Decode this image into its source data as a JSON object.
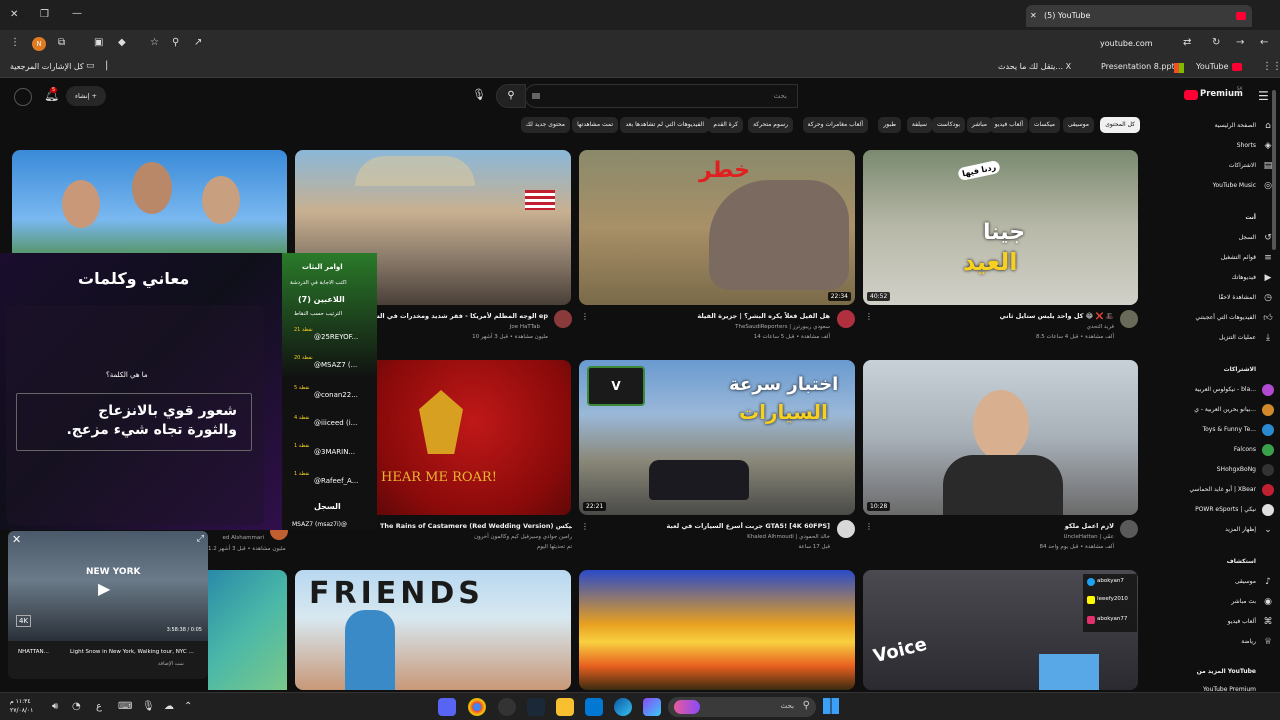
{
  "browser": {
    "tab_title": "(5) YouTube",
    "url": "youtube.com",
    "bookmarks": [
      {
        "label": "كل الإشارات المرجعية"
      },
      {
        "label": "يتقل لك ما يحدث... X"
      },
      {
        "label": "Presentation 8.pptx"
      },
      {
        "label": "YouTube"
      }
    ]
  },
  "youtube": {
    "logo_text": "Premium",
    "logo_badge": "SA",
    "create_label": "إنشاء",
    "notif_count": "5",
    "search_placeholder": "بحث",
    "chips": [
      "كل المحتوى",
      "موسيقى",
      "ميكسات",
      "ألعاب فيديو",
      "مباشر",
      "بودكاست",
      "سيلفة",
      "طبور",
      "ألعاب مغامرات وحركة",
      "رسوم متحركة",
      "كرة القدم",
      "الفيديوهات التي لم تشاهدها بعد",
      "تمت مشاهدتها",
      "محتوى جديد لك"
    ],
    "sidebar": {
      "main": [
        "الصفحة الرئيسية",
        "Shorts",
        "الاشتراكات",
        "YouTube Music"
      ],
      "you_header": "أنت",
      "you": [
        "السجل",
        "قوائم التشغيل",
        "فيديوهاتك",
        "المشاهدة لاحقًا",
        "الفيديوهات التي أعجبتني",
        "عمليات التنزيل"
      ],
      "subs_header": "الاشتراكات",
      "subs": [
        "نيكولوس العربية - bla...",
        "بيانو بحرين العربية - ي...",
        "Toys & Funny Te...",
        "Falcons",
        "SHohgxBoNg",
        "أبو غايد الحماسي | XBear",
        "POWR eSports | نيكي",
        "إظهار المزيد"
      ],
      "explore_header": "استكشاف",
      "explore": [
        "موسيقى",
        "بث مباشر",
        "ألعاب فيديو",
        "رياضة"
      ],
      "more_header": "المزيد من YouTube",
      "more": [
        "YouTube Premium"
      ]
    },
    "videos_row1": [
      {
        "title": "",
        "channel": "",
        "meta": "",
        "duration": ""
      },
      {
        "title": "الوجه المظلم لأمريكا - فقر شديد ومخدرات في الشارع ep",
        "channel": "Joe HaTTab",
        "meta": "10 مليون مشاهدة • قبل 3 أشهر",
        "duration": ""
      },
      {
        "title": "هل الفيل فعلاً يكره البشر؟ | جزيرة الفيلة",
        "channel": "TheSaudiReporters | سعودي ريبورترز",
        "meta": "14 ألف مشاهدة • قبل 5 ساعات",
        "duration": "22:34"
      },
      {
        "title": "كل واحد يلبس ستايل ثاني 😂 ❌ 🎩",
        "channel": "فريد التحدي",
        "meta": "8.5 ألف مشاهدة • قبل 4 ساعات",
        "duration": "40:52"
      }
    ],
    "videos_row2": [
      {
        "title": "",
        "channel": "ed Alshammari",
        "meta": "1.2 مليون مشاهدة • قبل 3 أشهر",
        "duration": ""
      },
      {
        "title": "The Rains of Castamere (Red Wedding Version) ميكس",
        "channel": "رامين جوادي وسيرفيل كيم وكالمون أخرون",
        "meta": "تم تحديثها اليوم",
        "duration": ""
      },
      {
        "title": "جربت أسرع السيارات في لعبة GTA5! [4K 60FPS]",
        "channel": "Khaled Alhmoudi | خالد الحمودي",
        "meta": "قبل 17 ساعة",
        "duration": "22:21"
      },
      {
        "title": "لازم اعمل ملكو",
        "channel": "UncleHattan | عمّي",
        "meta": "84 ألف مشاهدة • قبل يوم واحد",
        "duration": "10:28"
      }
    ],
    "thumb_texts": {
      "t3": "خطر",
      "t4a": "جينا",
      "t4b": "العيد",
      "t4c": "ردنا فيها",
      "t6": "HEAR ME ROAR!",
      "t7a": "اختبار سرعة",
      "t7b": "السيارات",
      "t10": "FRIENDS",
      "t12": "Voice"
    },
    "social": [
      "abokyan7",
      "Ieeefy2010",
      "abokyan77"
    ]
  },
  "overlay": {
    "title": "معاني وكلمات",
    "question": "ما هي الكلمة؟",
    "answer_line1": "شعور قوي بالانزعاج",
    "answer_line2": "والثورة تجاه شيء مزعج.",
    "cmd_header": "اوامر البثات",
    "cmd_sub": "اكتب الاجابة في الدردشة",
    "players_header": "اللاعبين (7)",
    "sort_label": "الترتيب حسب النقاط",
    "players": [
      {
        "name": "@25REYOF...",
        "points": "21 نقطة"
      },
      {
        "name": "@MSAZ7 (...",
        "points": "20 نقطة"
      },
      {
        "name": "@conan22...",
        "points": "5 نقطة"
      },
      {
        "name": "@iiiceed (i...",
        "points": "4 نقطة"
      },
      {
        "name": "@3MARIN...",
        "points": "1 نقطة"
      },
      {
        "name": "@Rafeef_A...",
        "points": "1 نقطة"
      }
    ],
    "log_header": "السجل",
    "log_entry": "MSAZ7 (msaz7i)@"
  },
  "miniplayer": {
    "title": "Light Snow in New York, Walking tour, NYC ...",
    "channel": "NHATTAN...",
    "time": "3:58:38 / 0:05",
    "quality": "4K",
    "city": "NEW YORK",
    "added": "تمت الإضافة"
  },
  "taskbar": {
    "search_placeholder": "بحث",
    "clock_time": "١١:٣٤ م",
    "clock_date": "٢٧/٠٨/٠١",
    "lang": "ع"
  }
}
